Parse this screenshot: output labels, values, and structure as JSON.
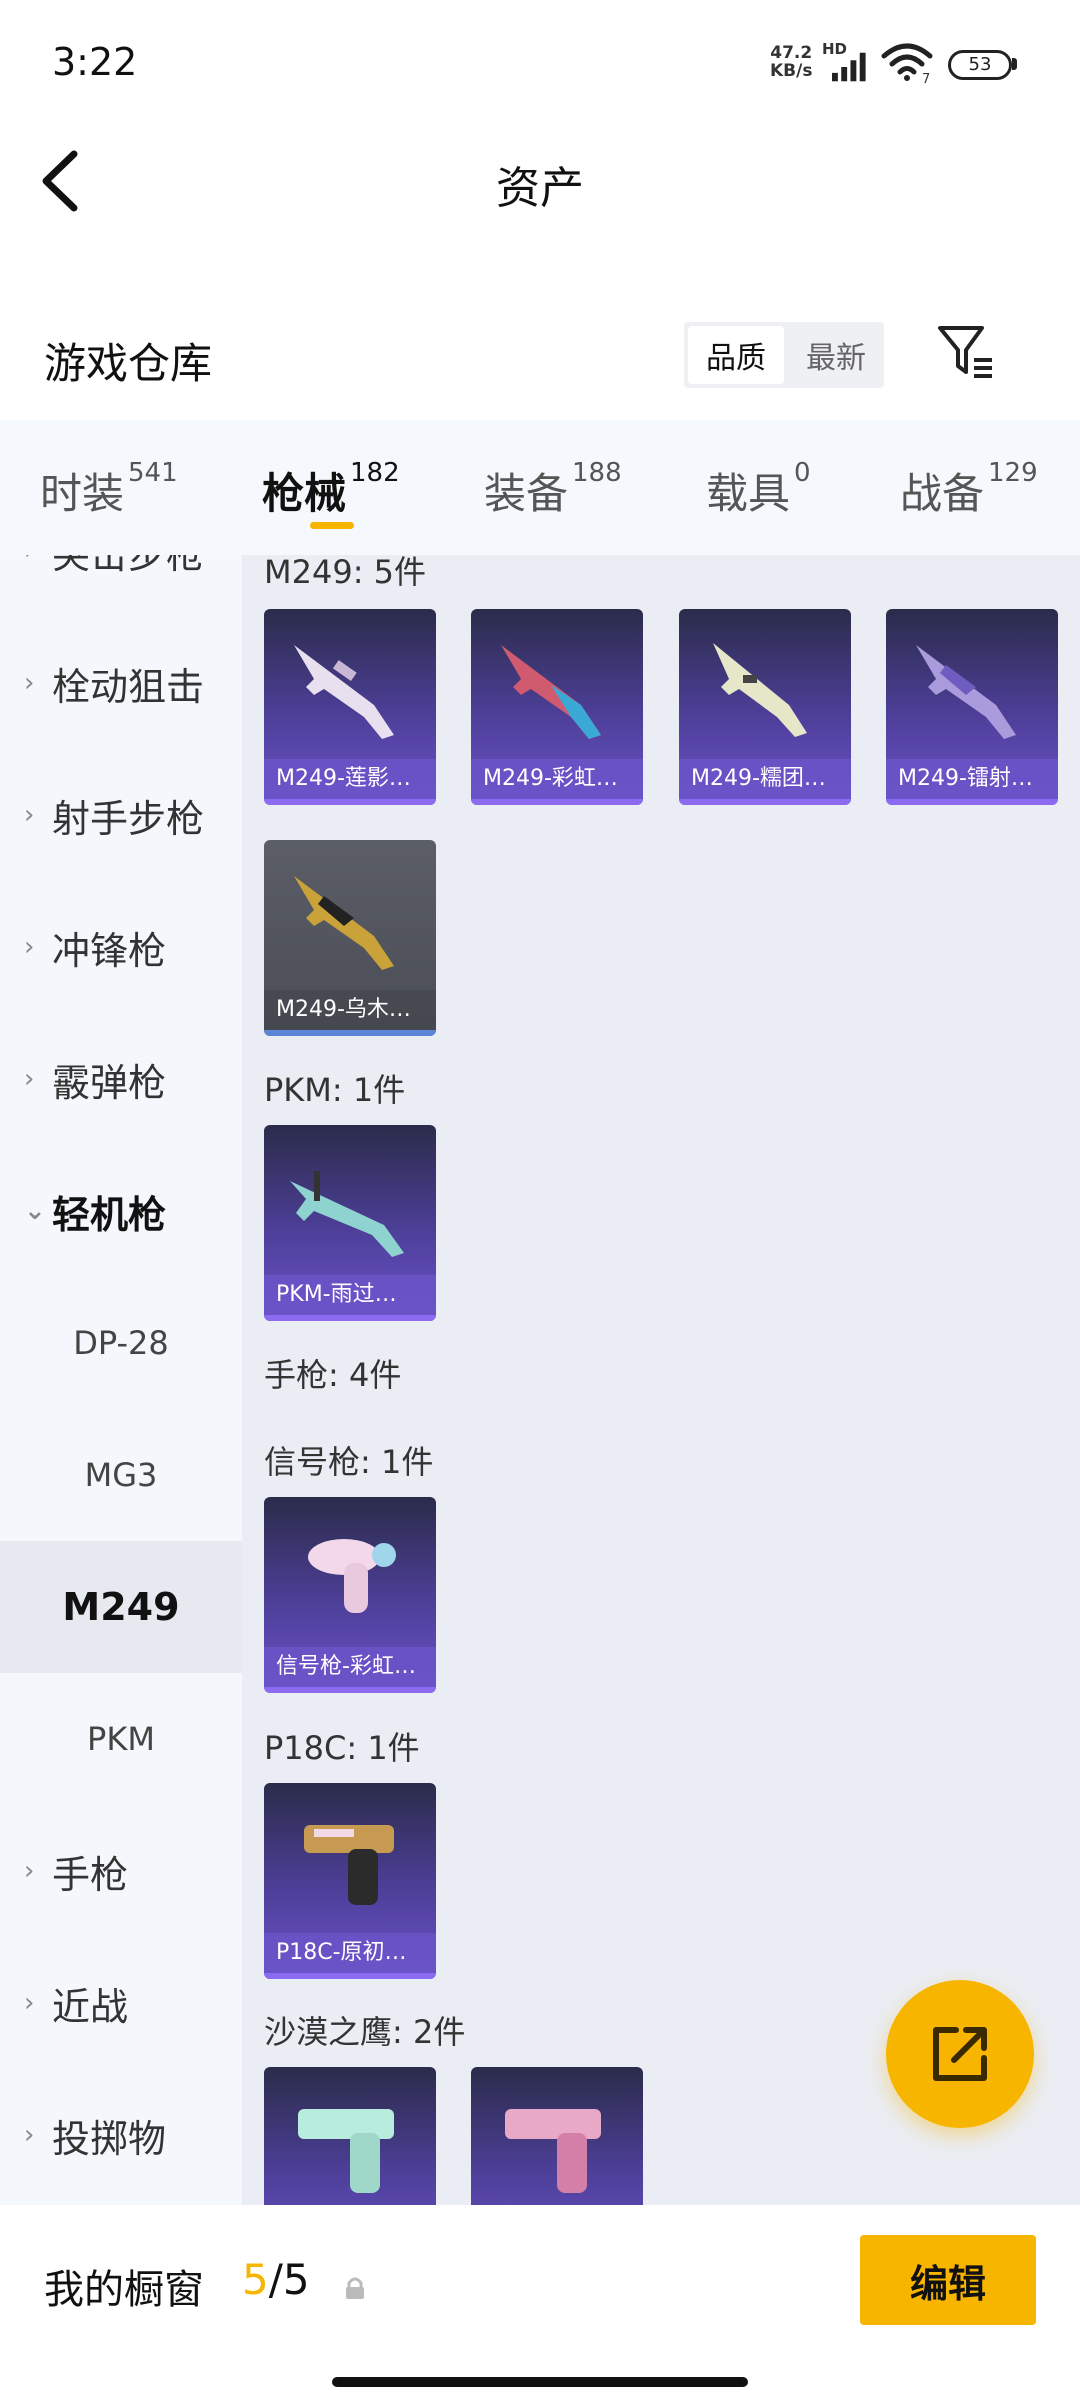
{
  "status_bar": {
    "time": "3:22",
    "net_speed": "47.2",
    "net_unit": "KB/s",
    "hd": "HD",
    "wifi_num": "7",
    "battery": "53"
  },
  "header": {
    "title": "资产"
  },
  "warehouse": {
    "title": "游戏仓库",
    "sort_options": [
      "品质",
      "最新"
    ],
    "sort_selected": "品质"
  },
  "tabs": [
    {
      "label": "时装",
      "count": "541"
    },
    {
      "label": "枪械",
      "count": "182",
      "active": true
    },
    {
      "label": "装备",
      "count": "188"
    },
    {
      "label": "载具",
      "count": "0"
    },
    {
      "label": "战备",
      "count": "129"
    }
  ],
  "sidebar": {
    "items": [
      {
        "label": "突击步枪"
      },
      {
        "label": "栓动狙击"
      },
      {
        "label": "射手步枪"
      },
      {
        "label": "冲锋枪"
      },
      {
        "label": "霰弹枪"
      },
      {
        "label": "轻机枪",
        "open": true
      }
    ],
    "subitems": [
      "DP-28",
      "MG3",
      "M249",
      "PKM"
    ],
    "selected_sub": "M249",
    "more_items": [
      {
        "label": "手枪"
      },
      {
        "label": "近战"
      },
      {
        "label": "投掷物"
      }
    ]
  },
  "content": {
    "sections": [
      {
        "title": "M249: 5件",
        "items": [
          "M249-莲影…",
          "M249-彩虹…",
          "M249-糯团…",
          "M249-镭射…",
          "M249-乌木…"
        ]
      },
      {
        "title": "PKM: 1件",
        "items": [
          "PKM-雨过…"
        ]
      },
      {
        "title": "手枪: 4件",
        "items": []
      },
      {
        "title": "信号枪: 1件",
        "items": [
          "信号枪-彩虹…"
        ]
      },
      {
        "title": "P18C: 1件",
        "items": [
          "P18C-原初…"
        ]
      },
      {
        "title": "沙漠之鹰: 2件",
        "items": [
          "",
          ""
        ]
      }
    ]
  },
  "bottom_bar": {
    "label": "我的橱窗",
    "count_current": "5",
    "count_sep": "/",
    "count_max": "5",
    "edit_label": "编辑"
  },
  "colors": {
    "accent": "#f7b500",
    "card_purple": "#6a54c8",
    "card_grey": "#4a4d55"
  },
  "icons": [
    "back-arrow-icon",
    "signal-icon",
    "wifi-icon",
    "battery-icon",
    "filter-icon",
    "chevron-right-icon",
    "chevron-down-icon",
    "share-icon",
    "lock-icon"
  ]
}
